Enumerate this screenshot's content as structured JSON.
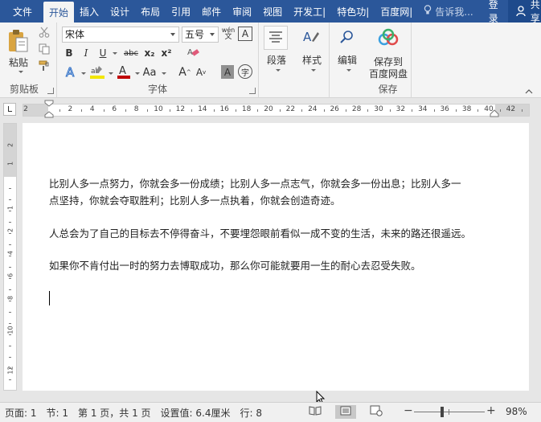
{
  "tabs": {
    "file": "文件",
    "items": [
      "开始",
      "插入",
      "设计",
      "布局",
      "引用",
      "邮件",
      "审阅",
      "视图",
      "开发工|",
      "特色功|",
      "百度网|"
    ],
    "help": "告诉我...",
    "login": "登录",
    "share": "共享"
  },
  "ribbon": {
    "clipboard": {
      "paste": "粘贴",
      "label": "剪贴板"
    },
    "font": {
      "name": "宋体",
      "size": "五号",
      "wen": "wén",
      "label": "字体",
      "bold": "B",
      "italic": "I",
      "underline": "U",
      "strike": "abc",
      "sub": "x₂",
      "sup": "x²",
      "grow": "A",
      "shrink": "A",
      "case": "Aa",
      "shade": "A",
      "char": "字",
      "wen_box": "A"
    },
    "paragraph": {
      "label": "段落"
    },
    "styles": {
      "label": "样式"
    },
    "edit": {
      "label": "编辑"
    },
    "save": {
      "line1": "保存到",
      "line2": "百度网盘",
      "group": "保存"
    }
  },
  "ruler": {
    "numbers": [
      "2",
      "2",
      "4",
      "6",
      "8",
      "10",
      "12",
      "14",
      "16",
      "18",
      "20",
      "22",
      "24",
      "26",
      "28",
      "30",
      "32",
      "34",
      "36",
      "38",
      "40",
      "42"
    ],
    "vertical": [
      "2",
      "1",
      "1",
      "2",
      "4",
      "6",
      "8",
      "10",
      "12"
    ]
  },
  "document": {
    "p1_line1": "比别人多一点努力，你就会多一份成绩；比别人多一点志气，你就会多一份出息；比别人多一",
    "p1_line2": "点坚持，你就会夺取胜利；比别人多一点执着，你就会创造奇迹。",
    "p2": "人总会为了自己的目标去不停得奋斗，不要埋怨眼前看似一成不变的生活，未来的路还很遥远。",
    "p3": "如果你不肯付出一时的努力去博取成功，那么你可能就要用一生的耐心去忍受失败。"
  },
  "status": {
    "page": "页面: 1",
    "section": "节: 1",
    "pages": "第 1 页，共 1 页",
    "setting": "设置值: 6.4厘米",
    "line": "行: 8",
    "zoom": "98%",
    "minus": "−",
    "plus": "+"
  },
  "colors": {
    "title_bar": "#2b579a",
    "ribbon_bg": "#f4f4f4",
    "highlight_yellow": "#f2e600",
    "font_red": "#c00000"
  }
}
